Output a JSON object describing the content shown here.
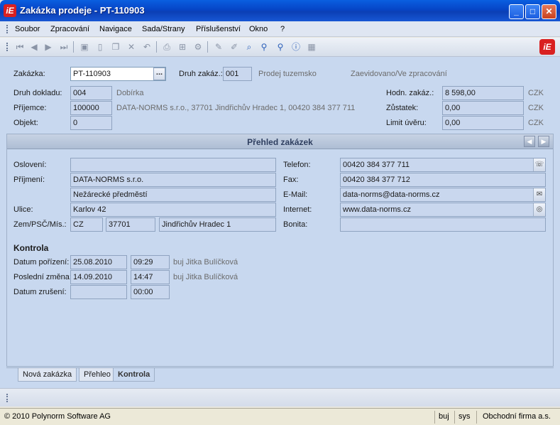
{
  "window": {
    "title": "Zakázka prodeje - PT-110903",
    "logo_text": "iE",
    "minimize": "_",
    "maximize": "□",
    "close": "✕"
  },
  "menu": [
    "Soubor",
    "Zpracování",
    "Navigace",
    "Sada/Strany",
    "Příslušenství",
    "Okno",
    "?"
  ],
  "toolbar_icons": [
    "first-icon",
    "prev-icon",
    "next-icon",
    "last-icon",
    "save-icon",
    "new-icon",
    "copy-icon",
    "delete-icon",
    "undo-icon",
    "print-icon",
    "tree-icon",
    "settings-icon",
    "edit-icon",
    "erase-icon",
    "find-icon",
    "zoom-icon",
    "zoom-plus-icon",
    "info-icon",
    "calculator-icon"
  ],
  "header": {
    "zakazka_label": "Zakázka:",
    "zakazka_value": "PT-110903",
    "browse_label": "...",
    "druh_zakaz_label": "Druh zakáz.:",
    "druh_zakaz_value": "001",
    "druh_zakaz_desc": "Prodej tuzemsko",
    "status": "Zaevidovano/Ve zpracování",
    "druh_dokladu_label": "Druh dokladu:",
    "druh_dokladu_value": "004",
    "druh_dokladu_desc": "Dobírka",
    "prijemce_label": "Příjemce:",
    "prijemce_value": "100000",
    "prijemce_desc": "DATA-NORMS s.r.o., 37701 Jindřichův Hradec 1, 00420 384 377 711",
    "objekt_label": "Objekt:",
    "objekt_value": "0",
    "hodn_label": "Hodn. zakáz.:",
    "hodn_value": "8 598,00",
    "zustatek_label": "Zůstatek:",
    "zustatek_value": "0,00",
    "limit_label": "Limit úvěru:",
    "limit_value": "0,00",
    "currency": "CZK"
  },
  "panel": {
    "title": "Přehled zakázek",
    "osloveni_label": "Oslovení:",
    "osloveni_value": "",
    "prijmeni_label": "Příjmení:",
    "prijmeni_value": "DATA-NORMS s.r.o.",
    "prijmeni_value2": "Nežárecké předměstí",
    "ulice_label": "Ulice:",
    "ulice_value": "Karlov 42",
    "zem_label": "Zem/PSČ/Mís.:",
    "zem_value": "CZ",
    "psc_value": "37701",
    "misto_value": "Jindřichův Hradec 1",
    "telefon_label": "Telefon:",
    "telefon_value": "00420 384 377 711",
    "fax_label": "Fax:",
    "fax_value": "00420 384 377 712",
    "email_label": "E-Mail:",
    "email_value": "data-norms@data-norms.cz",
    "internet_label": "Internet:",
    "internet_value": "www.data-norms.cz",
    "bonita_label": "Bonita:",
    "bonita_value": "",
    "kontrola_title": "Kontrola",
    "porizeni_label": "Datum pořízení:",
    "porizeni_date": "25.08.2010",
    "porizeni_time": "09:29",
    "porizeni_user": "buj  Jitka Bulíčková",
    "zmena_label": "Poslední změna:",
    "zmena_date": "14.09.2010",
    "zmena_time": "14:47",
    "zmena_user": "buj  Jitka Bulíčková",
    "zruseni_label": "Datum zrušení:",
    "zruseni_date": "",
    "zruseni_time": "00:00"
  },
  "tabs": [
    {
      "label": "Nová zakázka",
      "active": false
    },
    {
      "label": "Přehleo",
      "active": false
    },
    {
      "label": "Kontrola",
      "active": true
    }
  ],
  "status": {
    "copyright": "© 2010 Polynorm Software AG",
    "user": "buj",
    "db": "sys",
    "company": "Obchodní firma a.s."
  }
}
